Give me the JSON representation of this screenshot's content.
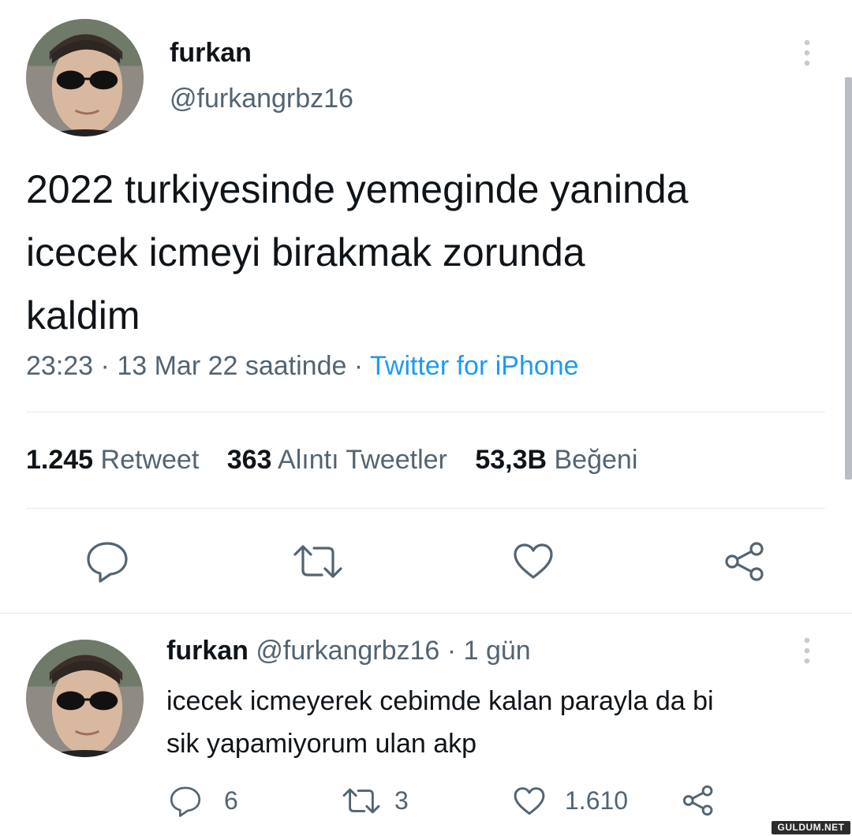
{
  "tweet": {
    "author_name": "furkan",
    "author_handle": "@furkangrbz16",
    "text_lines": [
      "2022 turkiyesinde yemeginde yaninda",
      "icecek icmeyi birakmak zorunda",
      "kaldim"
    ],
    "time": "23:23",
    "date": "13 Mar 22 saatinde",
    "separator": "·",
    "source": "Twitter for iPhone",
    "stats": {
      "retweets_count": "1.245",
      "retweets_label": "Retweet",
      "quotes_count": "363",
      "quotes_label": "Alıntı Tweetler",
      "likes_count": "53,3B",
      "likes_label": "Beğeni"
    },
    "icons": [
      "more-icon",
      "reply-icon",
      "retweet-icon",
      "like-icon",
      "share-icon"
    ]
  },
  "reply": {
    "author_name": "furkan",
    "author_handle": "@furkangrbz16",
    "separator": "·",
    "time_ago": "1 gün",
    "text_lines": [
      "icecek icmeyerek cebimde kalan parayla da bi",
      "sik yapamiyorum ulan akp"
    ],
    "reply_count": "6",
    "retweet_count": "3",
    "like_count": "1.610",
    "icons": [
      "more-icon",
      "reply-icon",
      "retweet-icon",
      "like-icon",
      "share-icon"
    ]
  },
  "watermark": "GULDUM.NET",
  "colors": {
    "text": "#0f1419",
    "muted": "#536471",
    "link": "#1d9bf0",
    "divider": "#e6e9ec"
  }
}
